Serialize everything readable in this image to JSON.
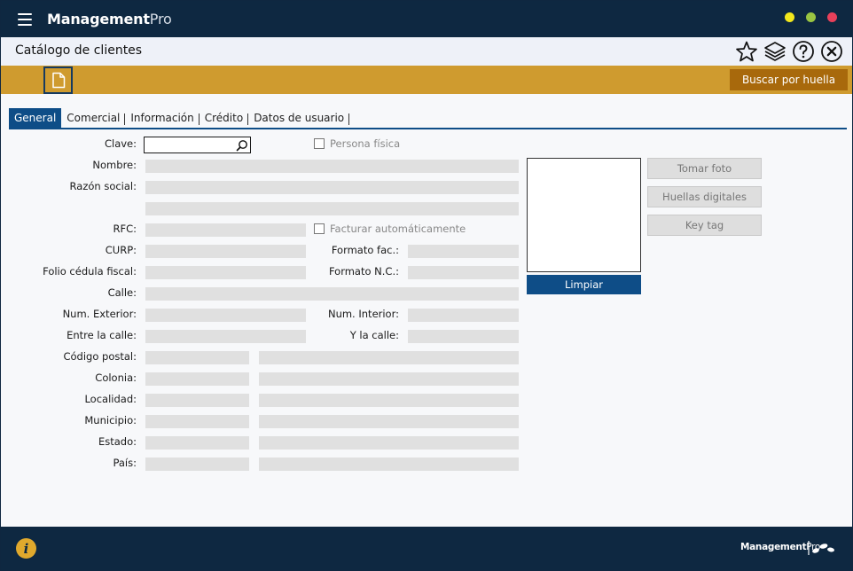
{
  "app": {
    "title_main": "Management",
    "title_suffix": "Pro"
  },
  "header": {
    "page_title": "Catálogo de clientes",
    "icons": [
      "star-icon",
      "layers-icon",
      "help-icon",
      "close-icon"
    ]
  },
  "toolbar": {
    "fingerprint_search_label": "Buscar por huella"
  },
  "tabs": [
    {
      "label": "General",
      "active": true
    },
    {
      "label": "Comercial",
      "active": false
    },
    {
      "label": "Información",
      "active": false
    },
    {
      "label": "Crédito",
      "active": false
    },
    {
      "label": "Datos de usuario",
      "active": false
    }
  ],
  "form": {
    "clave_label": "Clave:",
    "clave_value": "",
    "persona_fisica_label": "Persona física",
    "persona_fisica_checked": false,
    "nombre_label": "Nombre:",
    "razon_social_label": "Razón social:",
    "rfc_label": "RFC:",
    "facturar_auto_label": "Facturar automáticamente",
    "facturar_auto_checked": false,
    "curp_label": "CURP:",
    "formato_fac_label": "Formato fac.:",
    "folio_cedula_label": "Folio cédula fiscal:",
    "formato_nc_label": "Formato N.C.:",
    "calle_label": "Calle:",
    "num_exterior_label": "Num. Exterior:",
    "num_interior_label": "Num. Interior:",
    "entre_calle_label": "Entre la calle:",
    "y_calle_label": "Y la calle:",
    "codigo_postal_label": "Código postal:",
    "colonia_label": "Colonia:",
    "localidad_label": "Localidad:",
    "municipio_label": "Municipio:",
    "estado_label": "Estado:",
    "pais_label": "País:"
  },
  "photo": {
    "clear_label": "Limpiar",
    "take_photo_label": "Tomar foto",
    "fingerprints_label": "Huellas digitales",
    "key_tag_label": "Key tag"
  },
  "footer": {
    "logo_main": "Management",
    "logo_suffix": "Pro"
  },
  "colors": {
    "navy": "#0e2841",
    "accent_blue": "#0e4d87",
    "toolbar_gold": "#cf9b2f",
    "button_brown": "#a8690c",
    "info_gold": "#e0a92d"
  }
}
